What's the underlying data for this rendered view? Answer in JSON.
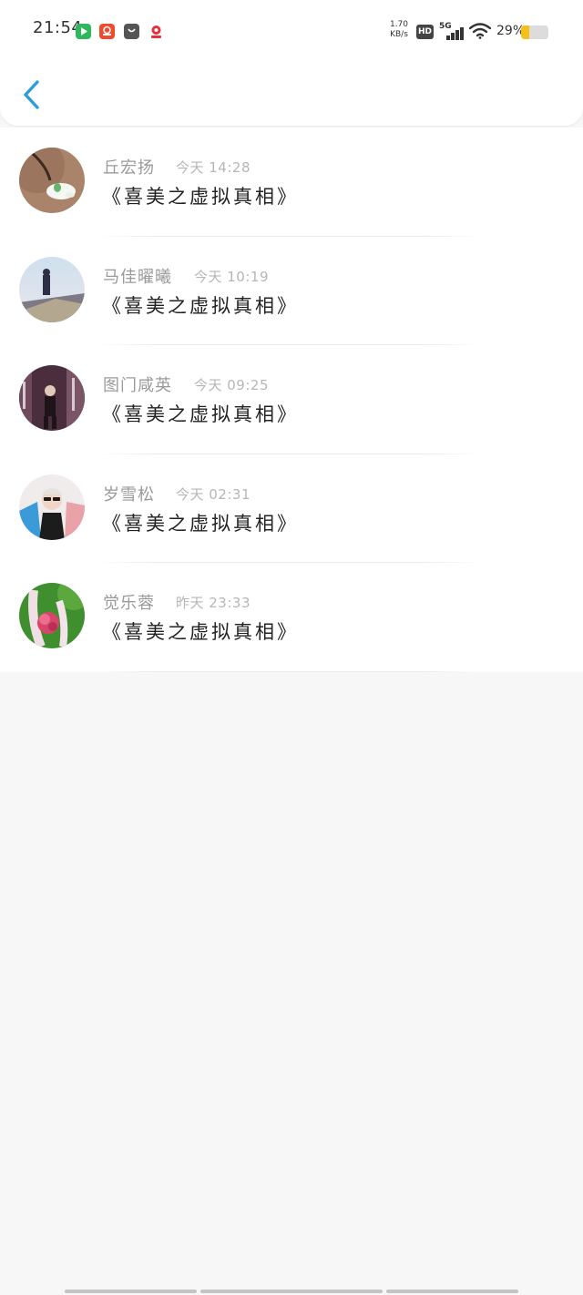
{
  "status_bar": {
    "time": "21:54",
    "app_icons": [
      {
        "name": "video-app-icon",
        "color": "#2eb85c"
      },
      {
        "name": "shopping-app-icon",
        "color": "#f0492b"
      },
      {
        "name": "store-bag-icon",
        "color": "#555555"
      },
      {
        "name": "map-pin-app-icon",
        "color": "#e8303a"
      }
    ],
    "net_speed_value": "1.70",
    "net_speed_unit": "KB/s",
    "hd_label": "HD",
    "signal_label": "5G",
    "battery_percent": "29%",
    "battery_level": 0.29
  },
  "nav": {
    "back_icon": "chevron-left-icon",
    "accent_color": "#2d9cdb"
  },
  "messages": [
    {
      "name": "丘宏扬",
      "time": "今天 14:28",
      "text": "《喜美之虚拟真相》",
      "avatar": "toy-figure-avatar"
    },
    {
      "name": "马佳曜曦",
      "time": "今天 10:19",
      "text": "《喜美之虚拟真相》",
      "avatar": "person-sky-avatar"
    },
    {
      "name": "图门咸英",
      "time": "今天 09:25",
      "text": "《喜美之虚拟真相》",
      "avatar": "stage-portrait-avatar"
    },
    {
      "name": "岁雪松",
      "time": "今天 02:31",
      "text": "《喜美之虚拟真相》",
      "avatar": "sunglasses-person-avatar"
    },
    {
      "name": "觉乐蓉",
      "time": "昨天 23:33",
      "text": "《喜美之虚拟真相》",
      "avatar": "red-flower-avatar"
    }
  ]
}
